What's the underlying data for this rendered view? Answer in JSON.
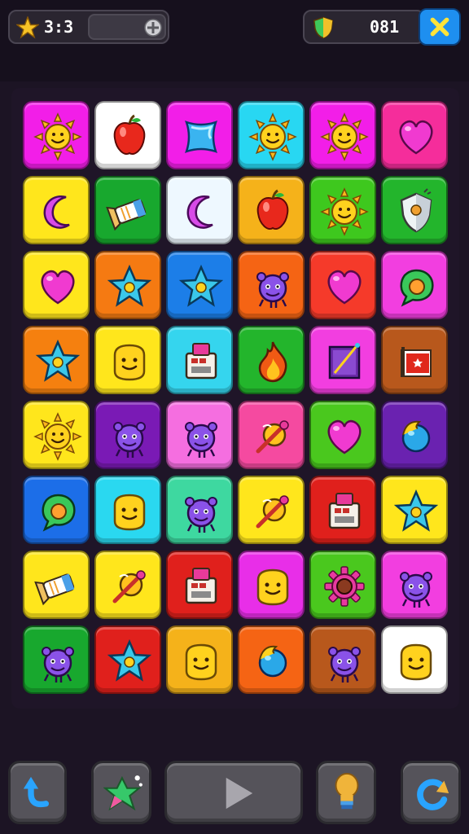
{
  "hud": {
    "stars_value": "3:3",
    "gems_value": "081",
    "star_icon": "star-icon",
    "add_icon": "plus-icon",
    "shield_icon": "shield-icon",
    "close_icon": "close-icon"
  },
  "board": {
    "rows": [
      [
        {
          "color": "#f21ee8",
          "icon": "sun-icon"
        },
        {
          "color": "#ffffff",
          "icon": "apple-icon"
        },
        {
          "color": "#f21ee8",
          "icon": "gem-icon"
        },
        {
          "color": "#28d7f2",
          "icon": "sun-icon"
        },
        {
          "color": "#f21ee8",
          "icon": "sun-icon"
        },
        {
          "color": "#f52d9b",
          "icon": "heart-icon"
        }
      ],
      [
        {
          "color": "#ffe61c",
          "icon": "moon-icon"
        },
        {
          "color": "#18a82e",
          "icon": "candy-icon"
        },
        {
          "color": "#eef8ff",
          "icon": "moon-icon"
        },
        {
          "color": "#f5b21a",
          "icon": "apple-icon"
        },
        {
          "color": "#3ec81e",
          "icon": "sun-icon"
        },
        {
          "color": "#23b52c",
          "icon": "shield-icon"
        }
      ],
      [
        {
          "color": "#ffe61c",
          "icon": "heart-icon"
        },
        {
          "color": "#f57a12",
          "icon": "star-icon"
        },
        {
          "color": "#1c7ee8",
          "icon": "star-icon"
        },
        {
          "color": "#f56414",
          "icon": "monster-icon"
        },
        {
          "color": "#f53a2a",
          "icon": "heart-icon"
        },
        {
          "color": "#f23ee0",
          "icon": "bubble-icon"
        }
      ],
      [
        {
          "color": "#f5800f",
          "icon": "star-icon"
        },
        {
          "color": "#ffe61c",
          "icon": "face-icon"
        },
        {
          "color": "#35d5ee",
          "icon": "box-icon"
        },
        {
          "color": "#23b52c",
          "icon": "flame-icon"
        },
        {
          "color": "#f23ee0",
          "icon": "book-icon"
        },
        {
          "color": "#b8581c",
          "icon": "card-icon"
        }
      ],
      [
        {
          "color": "#ffe61c",
          "icon": "sun-icon"
        },
        {
          "color": "#7a1ab5",
          "icon": "monster-icon"
        },
        {
          "color": "#f56ee0",
          "icon": "monster-icon"
        },
        {
          "color": "#f54aa0",
          "icon": "wand-icon"
        },
        {
          "color": "#4ac81e",
          "icon": "heart-icon"
        },
        {
          "color": "#6a22b0",
          "icon": "orb-icon"
        }
      ],
      [
        {
          "color": "#1c6ee8",
          "icon": "bubble-icon"
        },
        {
          "color": "#2ad8f0",
          "icon": "face-icon"
        },
        {
          "color": "#3ed8a0",
          "icon": "monster-icon"
        },
        {
          "color": "#ffe61c",
          "icon": "wand-icon"
        },
        {
          "color": "#e0201c",
          "icon": "box-icon"
        },
        {
          "color": "#ffe61c",
          "icon": "star-icon"
        }
      ],
      [
        {
          "color": "#ffe61c",
          "icon": "candy-icon"
        },
        {
          "color": "#ffe61c",
          "icon": "wand-icon"
        },
        {
          "color": "#e0201c",
          "icon": "box-icon"
        },
        {
          "color": "#e82ee8",
          "icon": "face-icon"
        },
        {
          "color": "#4ac81e",
          "icon": "gear-icon"
        },
        {
          "color": "#f23ee0",
          "icon": "monster-icon"
        }
      ],
      [
        {
          "color": "#18a82e",
          "icon": "monster-icon"
        },
        {
          "color": "#e0201c",
          "icon": "star-icon"
        },
        {
          "color": "#f5b21a",
          "icon": "face-icon"
        },
        {
          "color": "#f56414",
          "icon": "orb-icon"
        },
        {
          "color": "#b8581c",
          "icon": "monster-icon"
        },
        {
          "color": "#ffffff",
          "icon": "face-icon"
        }
      ]
    ]
  },
  "toolbar": {
    "buttons": [
      {
        "name": "undo-button",
        "icon": "undo-arrow-icon"
      },
      {
        "name": "shuffle-button",
        "icon": "sparkle-star-icon"
      },
      {
        "name": "play-button",
        "icon": "play-icon"
      },
      {
        "name": "hint-button",
        "icon": "lightbulb-icon"
      },
      {
        "name": "restart-button",
        "icon": "restart-icon"
      }
    ]
  }
}
